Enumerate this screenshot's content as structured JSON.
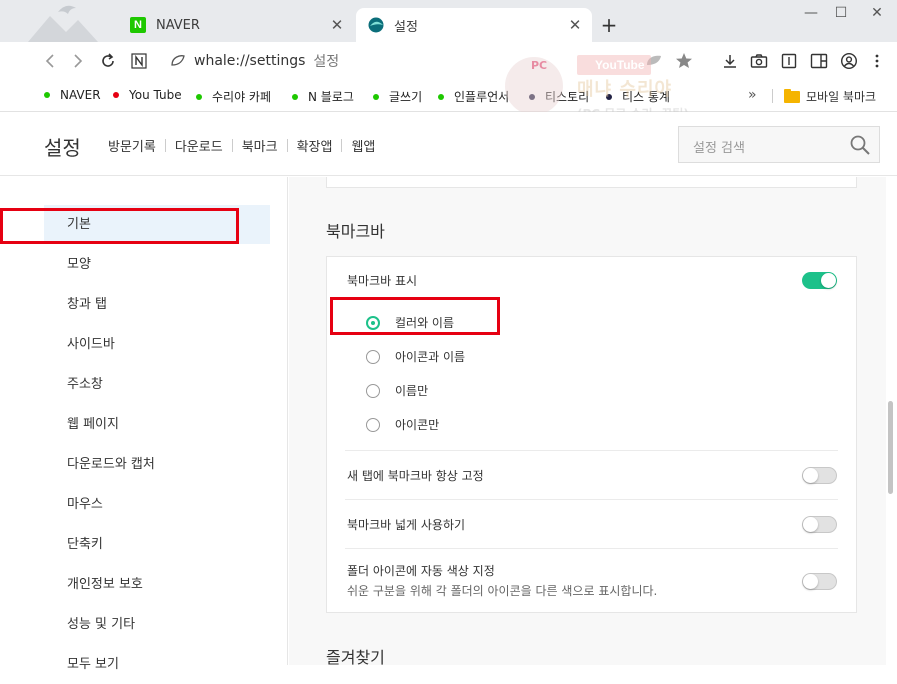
{
  "tabs": [
    {
      "label": "NAVER",
      "favicon": "naver-icon"
    },
    {
      "label": "설정",
      "favicon": "whale-icon"
    }
  ],
  "window": {
    "minimize": "—",
    "maximize": "☐",
    "close": "✕"
  },
  "toolbar": {
    "url": "whale://settings",
    "url_suffix": "설정"
  },
  "bookmarks": [
    {
      "label": "NAVER",
      "dot_color": "#1ec800"
    },
    {
      "label": "You Tube",
      "dot_color": "#e60012"
    },
    {
      "label": "수리야 카페",
      "dot_color": "#1ec800"
    },
    {
      "label": "N 블로그",
      "dot_color": "#1ec800"
    },
    {
      "label": "글쓰기",
      "dot_color": "#1ec800"
    },
    {
      "label": "인플루언서",
      "dot_color": "#1ec800"
    },
    {
      "label": "티스토리",
      "dot_color": "#222244"
    },
    {
      "label": "티스 통계",
      "dot_color": "#222244"
    }
  ],
  "bookmark_more": "»",
  "bookmark_folder": "모바일 북마크",
  "watermark": {
    "pc": "PC",
    "youtube": "YouTube",
    "title": "매냐 수리야",
    "sub": "(PC 무료 수리, 꿀팁)"
  },
  "settings": {
    "title": "설정",
    "nav": [
      "방문기록",
      "다운로드",
      "북마크",
      "확장앱",
      "웹앱"
    ],
    "search_placeholder": "설정 검색"
  },
  "sidebar": {
    "items": [
      "기본",
      "모양",
      "창과 탭",
      "사이드바",
      "주소창",
      "웹 페이지",
      "다운로드와 캡처",
      "마우스",
      "단축키",
      "개인정보 보호",
      "성능 및 기타",
      "모두 보기"
    ],
    "active": "기본"
  },
  "bookmark_bar_section": {
    "title": "북마크바",
    "show_label": "북마크바 표시",
    "show_enabled": true,
    "options": [
      "컬러와 이름",
      "아이콘과 이름",
      "이름만",
      "아이콘만"
    ],
    "selected": "컬러와 이름",
    "fix_label": "새 탭에 북마크바 항상 고정",
    "fix_enabled": false,
    "wide_label": "북마크바 넓게 사용하기",
    "wide_enabled": false,
    "folder_color_label": "폴더 아이콘에 자동 색상 지정",
    "folder_color_desc": "쉬운 구분을 위해 각 폴더의 아이콘을 다른 색으로 표시합니다.",
    "folder_color_enabled": false
  },
  "next_section_title": "즐겨찾기",
  "colors": {
    "accent": "#1dc18a",
    "highlight": "#e60012",
    "active_bg": "#eaf3fb"
  }
}
